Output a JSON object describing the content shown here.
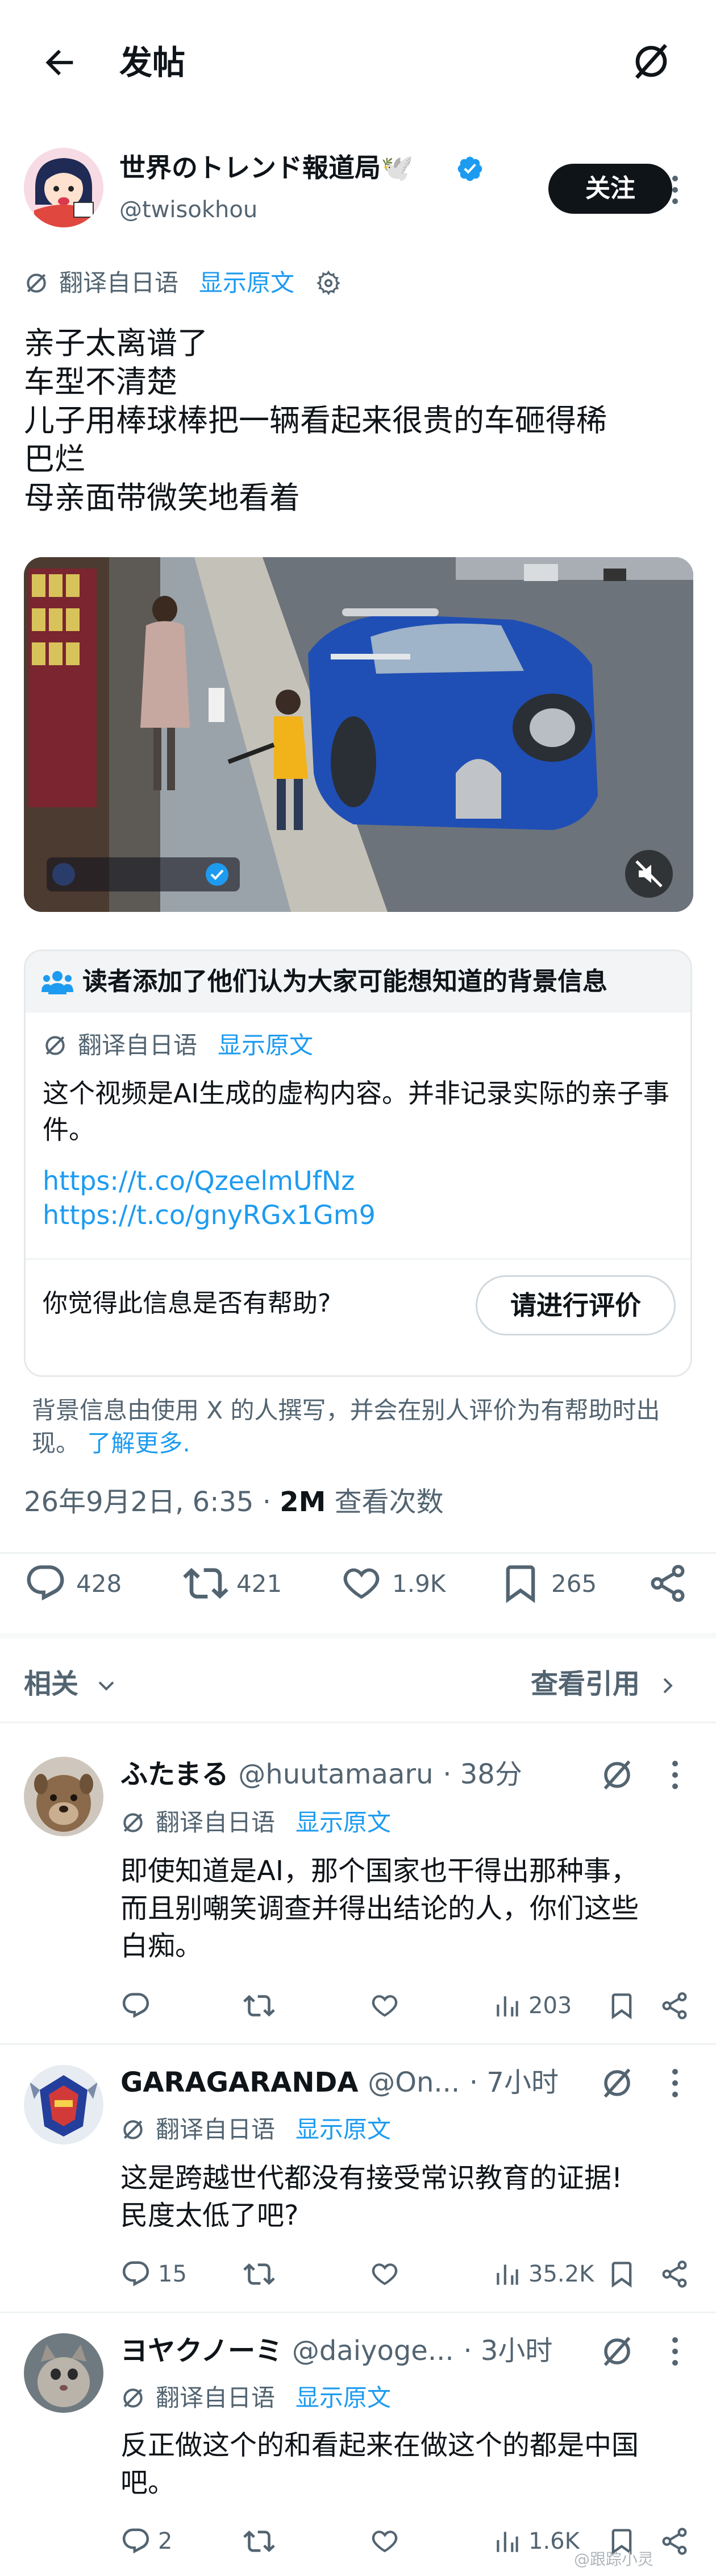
{
  "header": {
    "title": "发帖",
    "back_icon": "arrow-left-icon",
    "grok_icon": "grok-icon"
  },
  "post": {
    "author_name": "世界のトレンド報道局🕊️",
    "author_handle": "@twisokhou",
    "follow_label": "关注",
    "translated_label": "翻译自日语",
    "show_original_label": "显示原文",
    "text_lines": [
      "亲子太离谱了",
      "车型不清楚",
      "儿子用棒球棒把一辆看起来很贵的车砸得稀",
      "巴烂",
      "母亲面带微笑地看着"
    ],
    "timestamp": "26年9月2日, 6:35 · ",
    "views_count": "2M",
    "views_label": " 查看次数",
    "stats": {
      "replies": "428",
      "reposts": "421",
      "likes": "1.9K",
      "bookmarks": "265"
    }
  },
  "community_note": {
    "header": "读者添加了他们认为大家可能想知道的背景信息",
    "translated_label": "翻译自日语",
    "show_original_label": "显示原文",
    "body": "这个视频是AI生成的虚构内容。并非记录实际的亲子事件。",
    "links": [
      "https://t.co/QzeelmUfNz",
      "https://t.co/gnyRGx1Gm9"
    ],
    "question": "你觉得此信息是否有帮助?",
    "rate_label": "请进行评价",
    "footer_text": "背景信息由使用 X 的人撰写，并会在别人评价为有帮助时出现。",
    "learn_more": "了解更多."
  },
  "related": {
    "label": "相关",
    "quotes_label": "查看引用"
  },
  "replies": [
    {
      "name": "ふたまる",
      "handle": "@huutamaaru",
      "time": "· 38分",
      "translated_label": "翻译自日语",
      "show_original_label": "显示原文",
      "text_lines": [
        "即使知道是AI，那个国家也干得出那种事，",
        "而且别嘲笑调查并得出结论的人，你们这些",
        "白痴。"
      ],
      "replies_count": "",
      "views": "203"
    },
    {
      "name": "GARAGARANDA",
      "handle": "@On...",
      "time": "· 7小时",
      "translated_label": "翻译自日语",
      "show_original_label": "显示原文",
      "text_lines": [
        "这是跨越世代都没有接受常识教育的证据!",
        "民度太低了吧?"
      ],
      "replies_count": "15",
      "views": "35.2K"
    },
    {
      "name": "ヨヤクノーミ",
      "handle": "@daiyoge...",
      "time": "· 3小时",
      "translated_label": "翻译自日语",
      "show_original_label": "显示原文",
      "text_lines": [
        "反正做这个的和看起来在做这个的都是中国",
        "吧。"
      ],
      "replies_count": "2",
      "views": "1.6K"
    }
  ],
  "watermark": "@跟踪小灵",
  "colors": {
    "accent": "#1d9bf0",
    "text": "#0f1419",
    "muted": "#536471",
    "border": "#eff3f4"
  }
}
